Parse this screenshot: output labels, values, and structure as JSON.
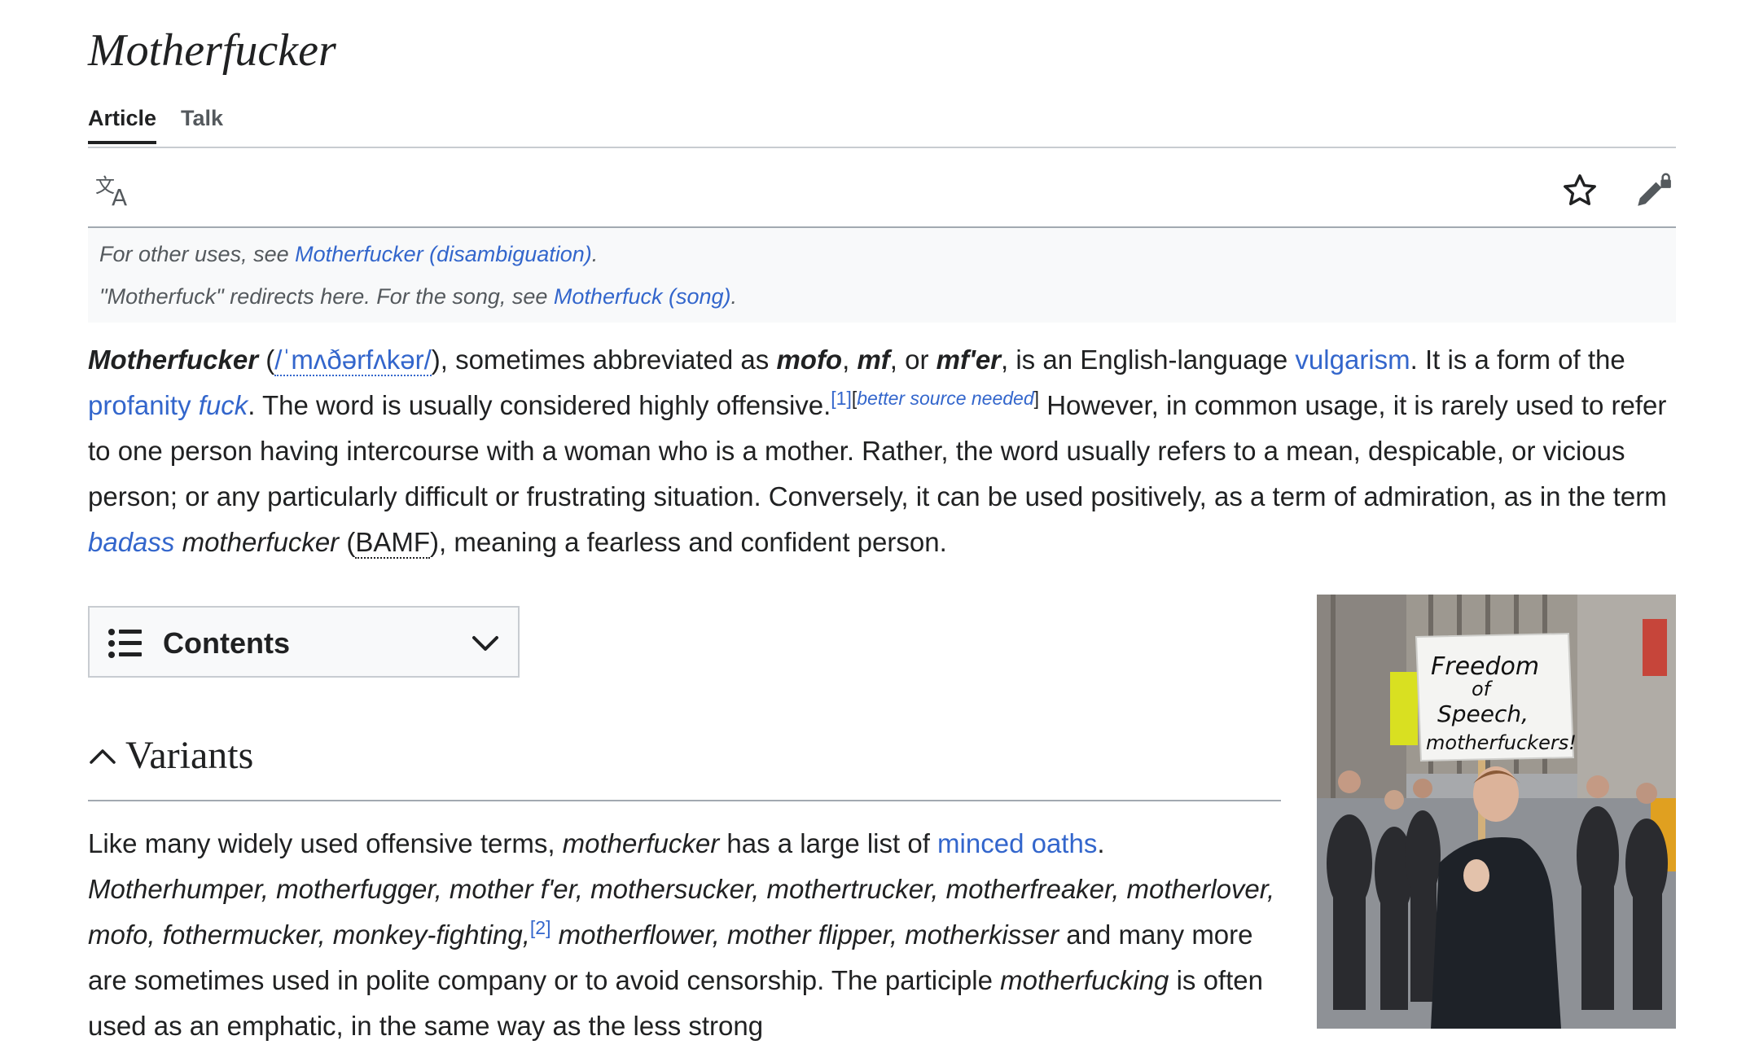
{
  "article": {
    "title": "Motherfucker",
    "tabs": [
      {
        "label": "Article"
      },
      {
        "label": "Talk"
      }
    ],
    "hatnotes": [
      {
        "prefix": "For other uses, see ",
        "link": "Motherfucker (disambiguation)",
        "suffix": "."
      },
      {
        "prefix": "\"Motherfuck\" redirects here. For the song, see ",
        "link": "Motherfuck (song)",
        "suffix": "."
      }
    ]
  },
  "toolbar": {
    "icons": {
      "language": "translate-icon",
      "watch": "star-icon",
      "edit": "edit-lock-icon"
    }
  },
  "lead": {
    "term": "Motherfucker",
    "open_paren": " (",
    "ipa": "/ˈmʌðərfʌkər/",
    "t1": "), sometimes abbreviated as ",
    "ab1": "mofo",
    "c1": ", ",
    "ab2": "mf",
    "c2": ", or ",
    "ab3": "mf'er",
    "t2": ", is an English-language ",
    "link_vulgarism": "vulgarism",
    "t3": ". It is a form of the ",
    "link_profanity": "profanity",
    "sp1": " ",
    "link_fuck": "fuck",
    "t4": ". The word is usually considered highly offensive.",
    "ref1": "[1]",
    "cn_open": "[",
    "cn_text": "better source needed",
    "cn_close": "]",
    "t5": " However, in common usage, it is rarely used to refer to one person having intercourse with a woman who is a mother. Rather, the word usually refers to a mean, despicable, or vicious person; or any particularly difficult or frustrating situation. Conversely, it can be used positively, as a term of admiration, as in the term ",
    "link_badass": "badass",
    "it_mf": " motherfucker",
    "p_open": " (",
    "abbr_bamf": "BAMF",
    "t6": "), meaning a fearless and confident person."
  },
  "toc": {
    "label": "Contents"
  },
  "section": {
    "title": "Variants",
    "t1": "Like many widely used offensive terms, ",
    "i1": "motherfucker",
    "t2": " has a large list of ",
    "link_minced": "minced oaths",
    "t3": ". ",
    "list_a": "Motherhumper, motherfugger, mother f'er, mothersucker, mothertrucker, motherfreaker, motherlover, mofo, fothermucker, monkey-fighting,",
    "ref2": "[2]",
    "list_b": " motherflower, mother flipper, motherkisser",
    "t4": " and many more are sometimes used in polite company or to avoid censorship. The participle ",
    "i2": "motherfucking",
    "t5": " is often used as an emphatic, in the same way as the less strong"
  },
  "image": {
    "sign_lines": [
      "Freedom",
      "of",
      "Speech,",
      "motherfuckers!"
    ],
    "colors": {
      "sign": "#f4f4f2",
      "coat": "#1e2228",
      "sky": "#b9bdc2",
      "street": "#8e9196"
    }
  },
  "colors": {
    "link": "#3366cc",
    "text": "#202122",
    "muted": "#54595d",
    "border": "#a2a9b1",
    "panel": "#f8f9fa"
  }
}
